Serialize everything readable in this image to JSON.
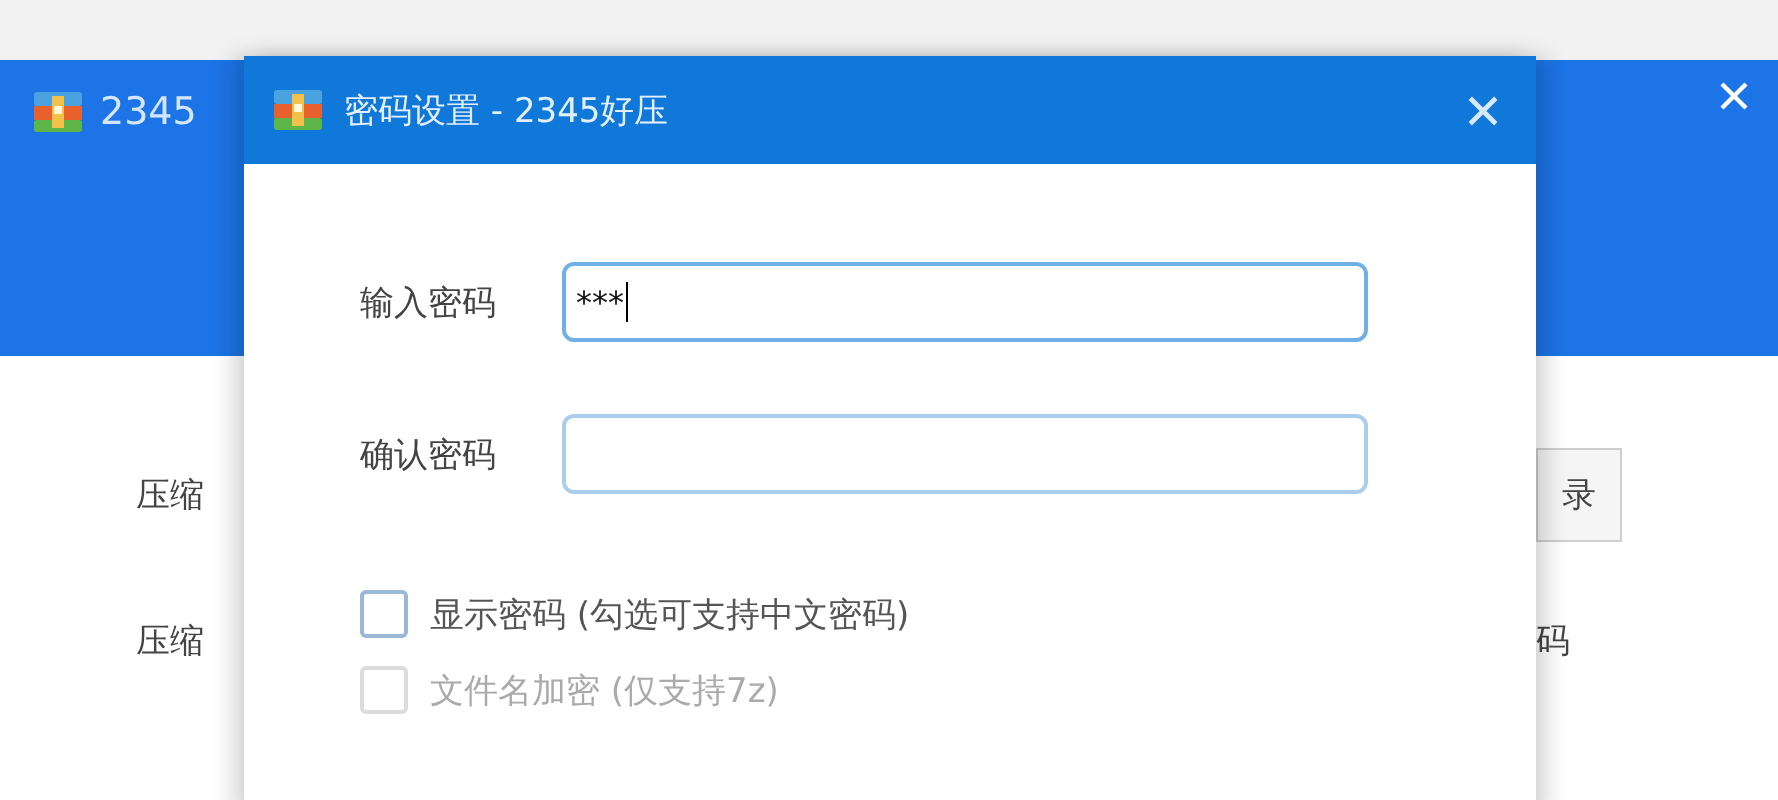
{
  "background_window": {
    "title": "2345",
    "rows": [
      {
        "label": "压缩",
        "button": "录"
      },
      {
        "label": "压缩",
        "trailing": "码"
      }
    ]
  },
  "dialog": {
    "title": "密码设置 - 2345好压",
    "fields": [
      {
        "label": "输入密码",
        "value": "***",
        "focused": true
      },
      {
        "label": "确认密码",
        "focused": false
      }
    ],
    "checkboxes": [
      {
        "label": "显示密码 (勾选可支持中文密码)",
        "checked": false,
        "disabled": false
      },
      {
        "label": "文件名加密 (仅支持7z)",
        "checked": false,
        "disabled": true
      }
    ]
  }
}
